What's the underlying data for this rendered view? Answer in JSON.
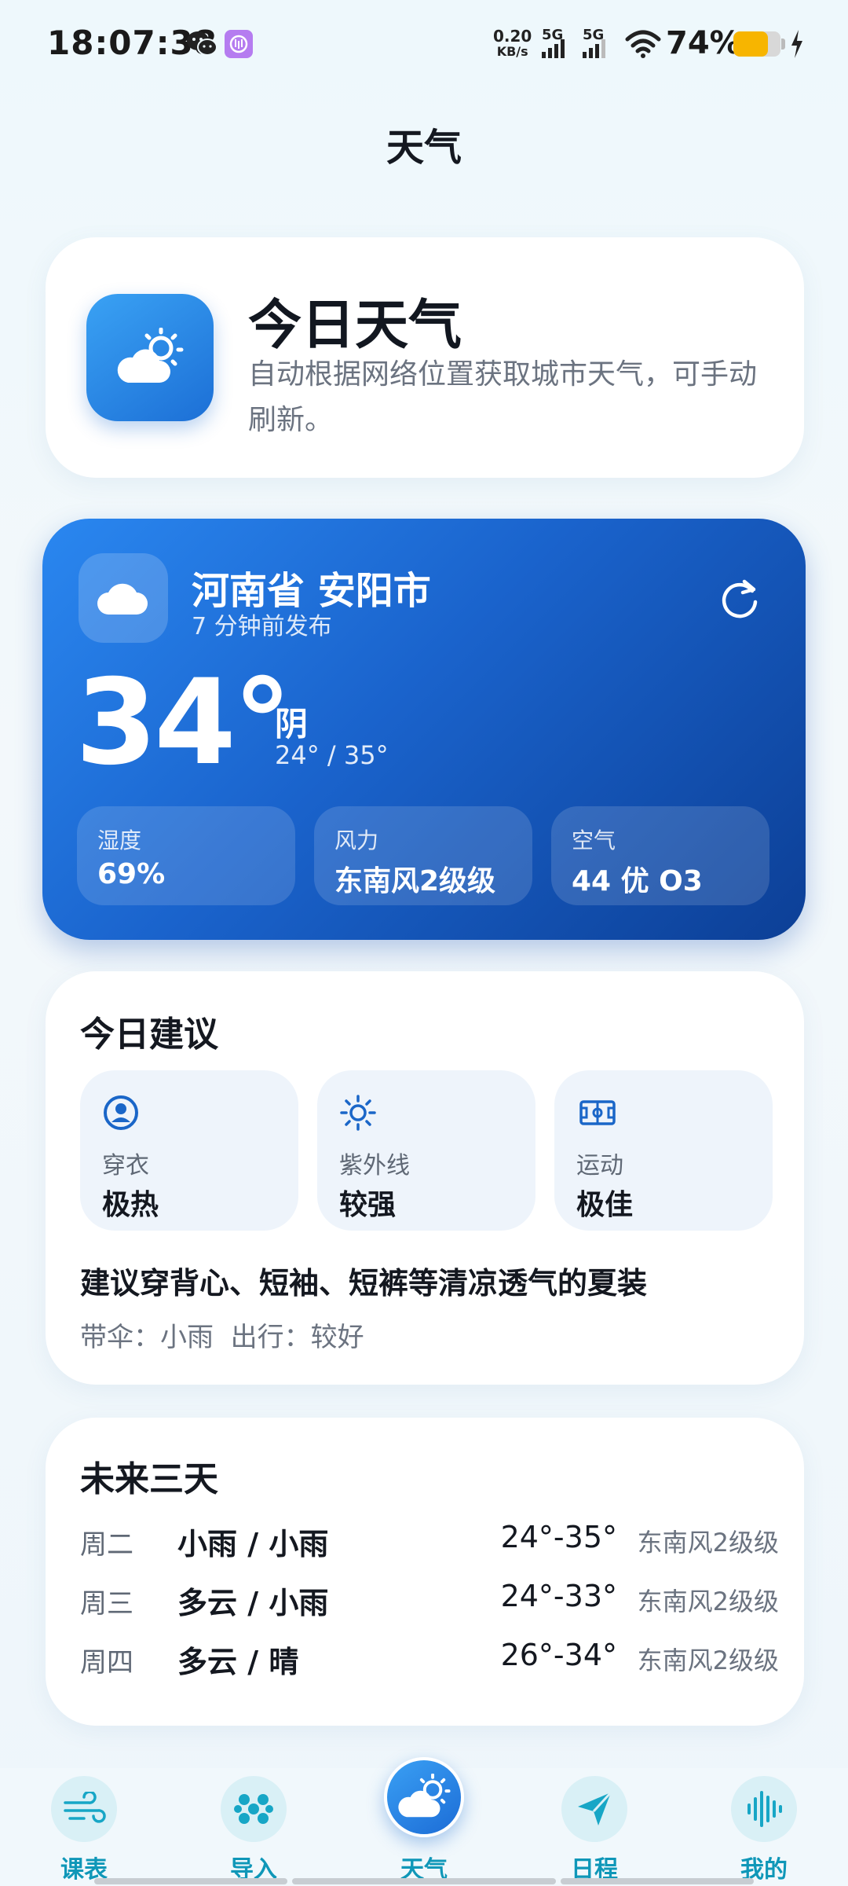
{
  "status_bar": {
    "time": "18:07:38",
    "net_speed_value": "0.20",
    "net_speed_unit": "KB/s",
    "sim1": "5G",
    "sim2": "5G",
    "battery": "74%",
    "battery_level": 0.74,
    "icons": [
      "wechat-icon",
      "app-notification-icon",
      "signal-icon",
      "wifi-icon",
      "battery-icon",
      "charging-icon"
    ]
  },
  "page": {
    "title": "天气"
  },
  "intro": {
    "title": "今日天气",
    "description": "自动根据网络位置获取城市天气，可手动刷新。",
    "icon": "partly-cloudy-icon"
  },
  "weather": {
    "city": "河南省 安阳市",
    "published": "7 分钟前发布",
    "temperature": "34°",
    "condition": "阴",
    "range": "24° / 35°",
    "stats": [
      {
        "label": "湿度",
        "value": "69%"
      },
      {
        "label": "风力",
        "value": "东南风2级级"
      },
      {
        "label": "空气",
        "value": "44 优 O3"
      }
    ],
    "colors": {
      "start": "#2a87f0",
      "end": "#0c3f96"
    }
  },
  "advice": {
    "title": "今日建议",
    "tiles": [
      {
        "label": "穿衣",
        "value": "极热",
        "icon": "person-icon"
      },
      {
        "label": "紫外线",
        "value": "较强",
        "icon": "sun-icon"
      },
      {
        "label": "运动",
        "value": "极佳",
        "icon": "court-icon"
      }
    ],
    "description": "建议穿背心、短袖、短裤等清凉透气的夏装",
    "extra": "带伞：小雨  出行：较好"
  },
  "forecast": {
    "title": "未来三天",
    "days": [
      {
        "day": "周二",
        "condition": "小雨 / 小雨",
        "temp": "24°-35°",
        "wind": "东南风2级级"
      },
      {
        "day": "周三",
        "condition": "多云 / 小雨",
        "temp": "24°-33°",
        "wind": "东南风2级级"
      },
      {
        "day": "周四",
        "condition": "多云 / 晴",
        "temp": "26°-34°",
        "wind": "东南风2级级"
      }
    ]
  },
  "nav": {
    "items": [
      {
        "label": "课表",
        "icon": "wind-icon"
      },
      {
        "label": "导入",
        "icon": "dots-icon"
      },
      {
        "label": "天气",
        "icon": "partly-cloudy-icon",
        "active": true
      },
      {
        "label": "日程",
        "icon": "send-icon"
      },
      {
        "label": "我的",
        "icon": "soundwave-icon"
      }
    ],
    "accent": "#0f97b8"
  }
}
